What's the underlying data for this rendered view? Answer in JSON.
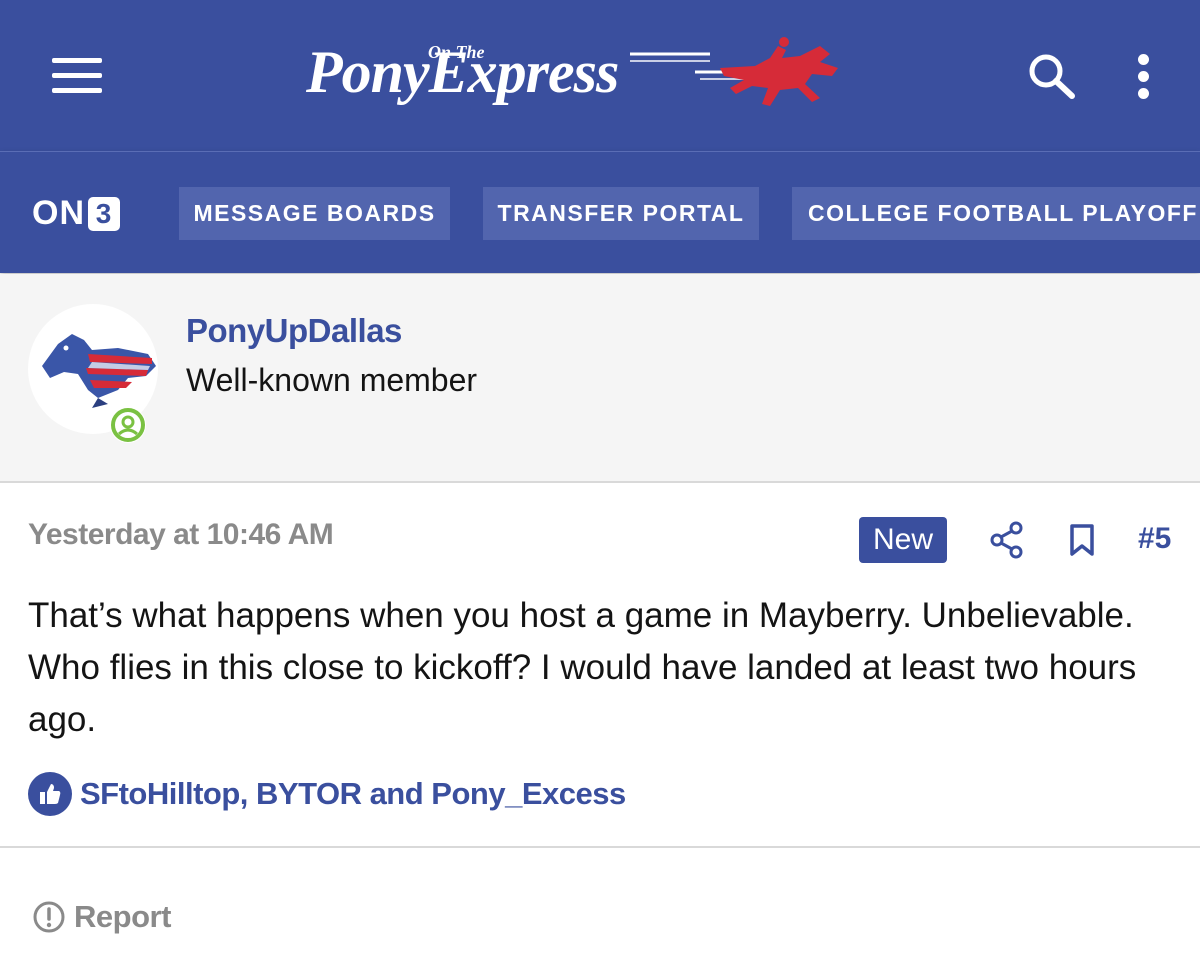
{
  "header": {
    "menu_icon": "hamburger-menu-icon",
    "logo_small_text": "On The",
    "logo_main_text": "PonyExpress",
    "search_icon": "search-icon",
    "more_icon": "vertical-dots-icon",
    "logo_horse_color": "#d62b38",
    "background": "#3a4f9e"
  },
  "nav": {
    "brand_prefix": "ON",
    "brand_box": "3",
    "tabs": [
      {
        "label": "MESSAGE BOARDS"
      },
      {
        "label": "TRANSFER PORTAL"
      },
      {
        "label": "COLLEGE FOOTBALL PLAYOFF"
      }
    ]
  },
  "user": {
    "name": "PonyUpDallas",
    "title": "Well-known member",
    "status_icon": "online-user-icon",
    "status_color": "#7ac142"
  },
  "post": {
    "timestamp": "Yesterday at 10:46 AM",
    "badge": "New",
    "share_icon": "share-icon",
    "bookmark_icon": "bookmark-icon",
    "number": "#5",
    "body": "That’s what happens when you host a game in Mayberry. Unbelievable. Who flies in this close to kickoff? I would have landed at least two hours ago.",
    "reaction_icon": "thumbs-up-icon",
    "reactions": "SFtoHilltop, BYTOR and Pony_Excess",
    "report_icon": "exclamation-circle-icon",
    "report_label": "Report"
  }
}
